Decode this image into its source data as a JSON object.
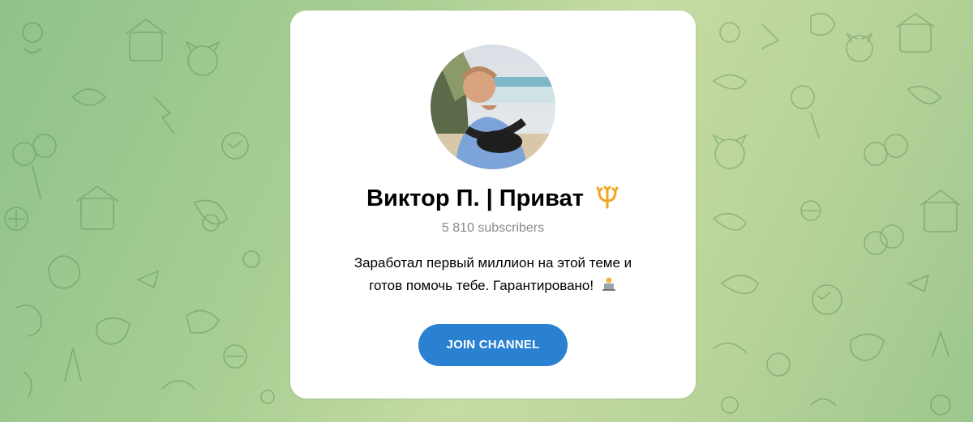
{
  "channel": {
    "title": "Виктор П. | Приват",
    "title_emoji": "trident-icon",
    "subscribers": "5 810 subscribers",
    "description_line1": "Заработал первый миллион на этой теме и",
    "description_line2": "готов помочь тебе. Гарантировано!",
    "description_emoji": "laptop-person-icon",
    "avatar": "channel-avatar-photo"
  },
  "actions": {
    "join_label": "JOIN CHANNEL"
  },
  "colors": {
    "accent": "#2a81d1",
    "background_start": "#8fc28a",
    "background_end": "#c6dba4",
    "trident": "#f2a51a"
  }
}
